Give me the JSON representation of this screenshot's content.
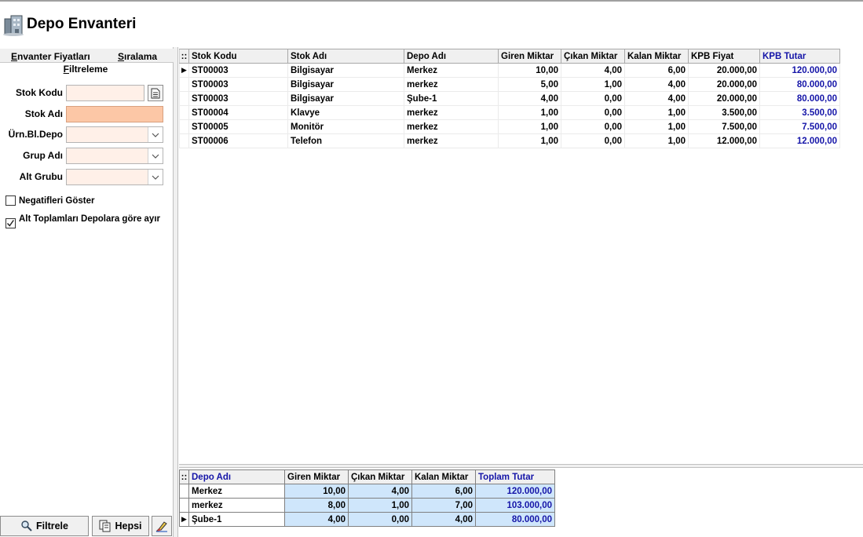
{
  "window": {
    "title": "Depo Envanteri",
    "icon": "warehouse-icon"
  },
  "left_panel": {
    "tabs": [
      {
        "label_pre": "",
        "label_u": "E",
        "label_post": "nvanter Fiyatları"
      },
      {
        "label_pre": "",
        "label_u": "S",
        "label_post": "ıralama"
      }
    ],
    "section_pre": "",
    "section_u": "F",
    "section_post": "iltreleme",
    "fields": {
      "stok_kodu": {
        "label": "Stok Kodu",
        "value": ""
      },
      "stok_adi": {
        "label": "Stok Adı",
        "value": ""
      },
      "urn_bl_depo": {
        "label": "Ürn.Bl.Depo",
        "value": ""
      },
      "grup_adi": {
        "label": "Grup Adı",
        "value": ""
      },
      "alt_grubu": {
        "label": "Alt Grubu",
        "value": ""
      }
    },
    "checkboxes": {
      "negatifleri": {
        "label": "Negatifleri Göster",
        "checked": false
      },
      "alt_toplamlari": {
        "label": "Alt Toplamları Depolara göre ayır",
        "checked": true
      }
    },
    "buttons": {
      "filtrele": "Filtrele",
      "hepsi": "Hepsi"
    }
  },
  "main_grid": {
    "headers": [
      "Stok Kodu",
      "Stok Adı",
      "Depo Adı",
      "Giren Miktar",
      "Çıkan Miktar",
      "Kalan Miktar",
      "KPB Fiyat",
      "KPB Tutar"
    ],
    "rows": [
      [
        "ST00003",
        "Bilgisayar",
        "Merkez",
        "10,00",
        "4,00",
        "6,00",
        "20.000,00",
        "120.000,00"
      ],
      [
        "ST00003",
        "Bilgisayar",
        "merkez",
        "5,00",
        "1,00",
        "4,00",
        "20.000,00",
        "80.000,00"
      ],
      [
        "ST00003",
        "Bilgisayar",
        "Şube-1",
        "4,00",
        "0,00",
        "4,00",
        "20.000,00",
        "80.000,00"
      ],
      [
        "ST00004",
        "Klavye",
        "merkez",
        "1,00",
        "0,00",
        "1,00",
        "3.500,00",
        "3.500,00"
      ],
      [
        "ST00005",
        "Monitör",
        "merkez",
        "1,00",
        "0,00",
        "1,00",
        "7.500,00",
        "7.500,00"
      ],
      [
        "ST00006",
        "Telefon",
        "merkez",
        "1,00",
        "0,00",
        "1,00",
        "12.000,00",
        "12.000,00"
      ]
    ],
    "selected_row": 0
  },
  "summary_grid": {
    "headers": [
      "Depo Adı",
      "Giren Miktar",
      "Çıkan Miktar",
      "Kalan Miktar",
      "Toplam Tutar"
    ],
    "rows": [
      [
        "Merkez",
        "10,00",
        "4,00",
        "6,00",
        "120.000,00"
      ],
      [
        "merkez",
        "8,00",
        "1,00",
        "7,00",
        "103.000,00"
      ],
      [
        "Şube-1",
        "4,00",
        "0,00",
        "4,00",
        "80.000,00"
      ]
    ],
    "selected_row": 2
  },
  "colors": {
    "accent_blue": "#1515a8",
    "input_bg": "#fff0e8",
    "input_active": "#fcc7a6",
    "summary_highlight": "#cfe6fb"
  }
}
